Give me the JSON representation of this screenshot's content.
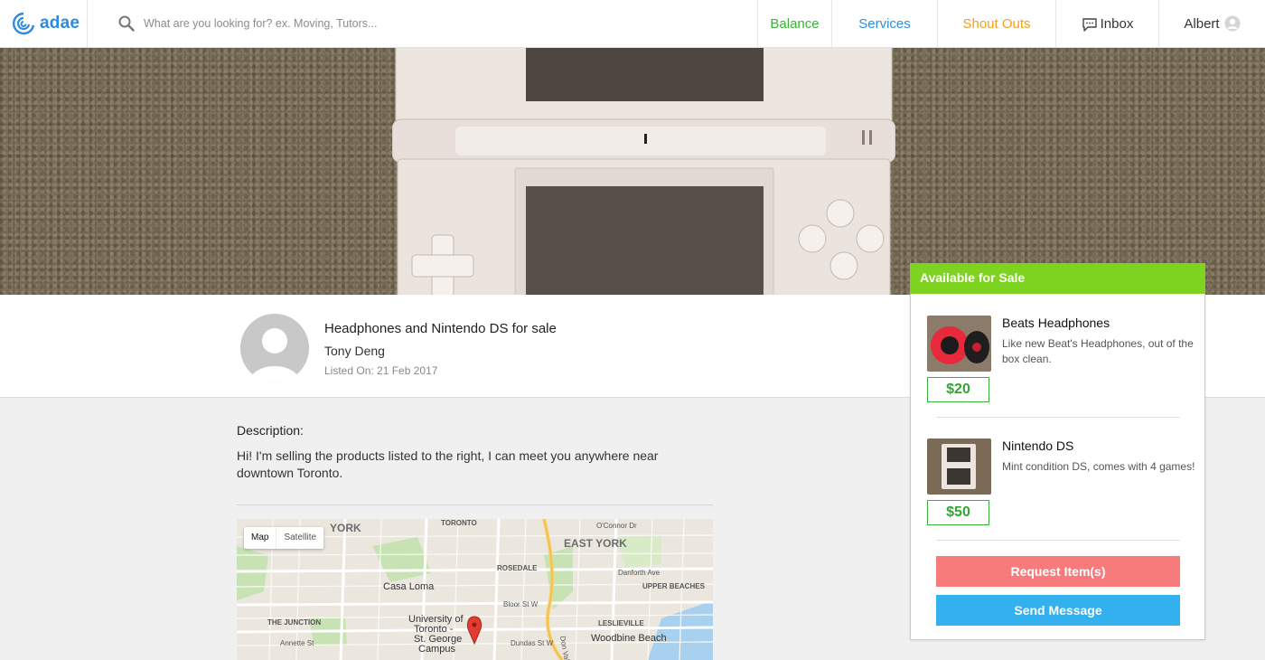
{
  "nav": {
    "logo_text": "adae",
    "search_placeholder": "What are you looking for? ex. Moving, Tutors...",
    "balance": "Balance",
    "services": "Services",
    "shout_outs": "Shout Outs",
    "inbox": "Inbox",
    "user": "Albert"
  },
  "listing": {
    "title": "Headphones and Nintendo DS for sale",
    "author": "Tony Deng",
    "listed_on": "Listed On: 21 Feb 2017",
    "description_label": "Description:",
    "description": "Hi! I'm selling the products listed to the right, I can meet you anywhere near downtown Toronto."
  },
  "map": {
    "toggle_map": "Map",
    "toggle_satellite": "Satellite",
    "labels": [
      "YORK",
      "TORONTO",
      "EAST YORK",
      "ROSEDALE",
      "Casa Loma",
      "THE JUNCTION",
      "University of",
      "Toronto -",
      "St. George",
      "Campus",
      "Woodbine Beach",
      "LESLIEVILLE",
      "UPPER BEACHES",
      "Bloor St W",
      "Dundas St W",
      "Don Valley Pkwy",
      "Danforth Ave",
      "Annette St",
      "O'Connor Dr"
    ]
  },
  "sale": {
    "header": "Available for Sale",
    "items": [
      {
        "name": "Beats Headphones",
        "description": "Like new Beat's Headphones, out of the box clean.",
        "price": "$20"
      },
      {
        "name": "Nintendo DS",
        "description": "Mint condition DS, comes with 4 games!",
        "price": "$50"
      }
    ],
    "request_button": "Request Item(s)",
    "message_button": "Send Message"
  },
  "colors": {
    "balance": "#3bb23b",
    "services": "#2f8fdf",
    "shout_outs": "#f0a020",
    "sale_header": "#7ed321",
    "request": "#f77b7b",
    "message": "#33b0ee"
  },
  "icons": [
    "logo-swirl-icon",
    "search-icon",
    "chat-bubble-icon",
    "user-avatar-icon",
    "map-pin-icon"
  ]
}
